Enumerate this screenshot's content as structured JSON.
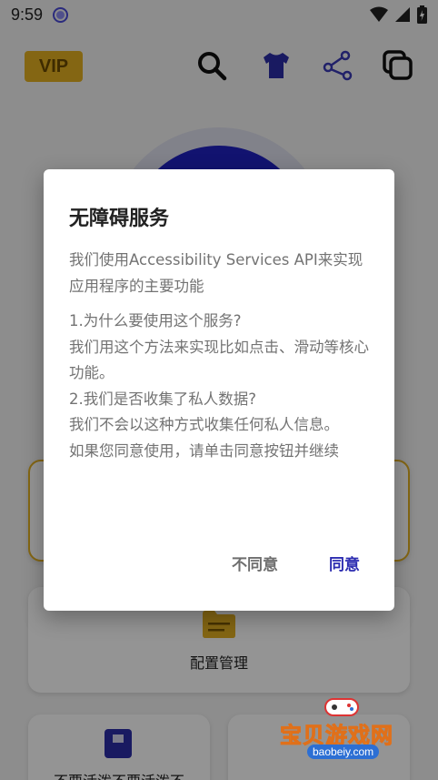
{
  "status_bar": {
    "time": "9:59"
  },
  "header": {
    "vip_label": "VIP",
    "icons": [
      "search-icon",
      "shirt-icon",
      "share-icon",
      "copy-icon"
    ],
    "colors": {
      "vip_bg": "#e3b022",
      "accent": "#1f21c2"
    }
  },
  "background": {
    "config_label": "配置管理",
    "bottom_label": "不要活泼不要活泼不"
  },
  "dialog": {
    "title": "无障碍服务",
    "intro": "我们使用Accessibility Services API来实现应用程序的主要功能",
    "q1": "1.为什么要使用这个服务?",
    "a1": "我们用这个方法来实现比如点击、滑动等核心功能。",
    "q2": "2.我们是否收集了私人数据?",
    "a2": "我们不会以这种方式收集任何私人信息。",
    "consent": "如果您同意使用，请单击同意按钮并继续",
    "disagree_label": "不同意",
    "agree_label": "同意"
  },
  "watermark": {
    "text": "宝贝游戏网",
    "sub": "baobeiy.com"
  }
}
